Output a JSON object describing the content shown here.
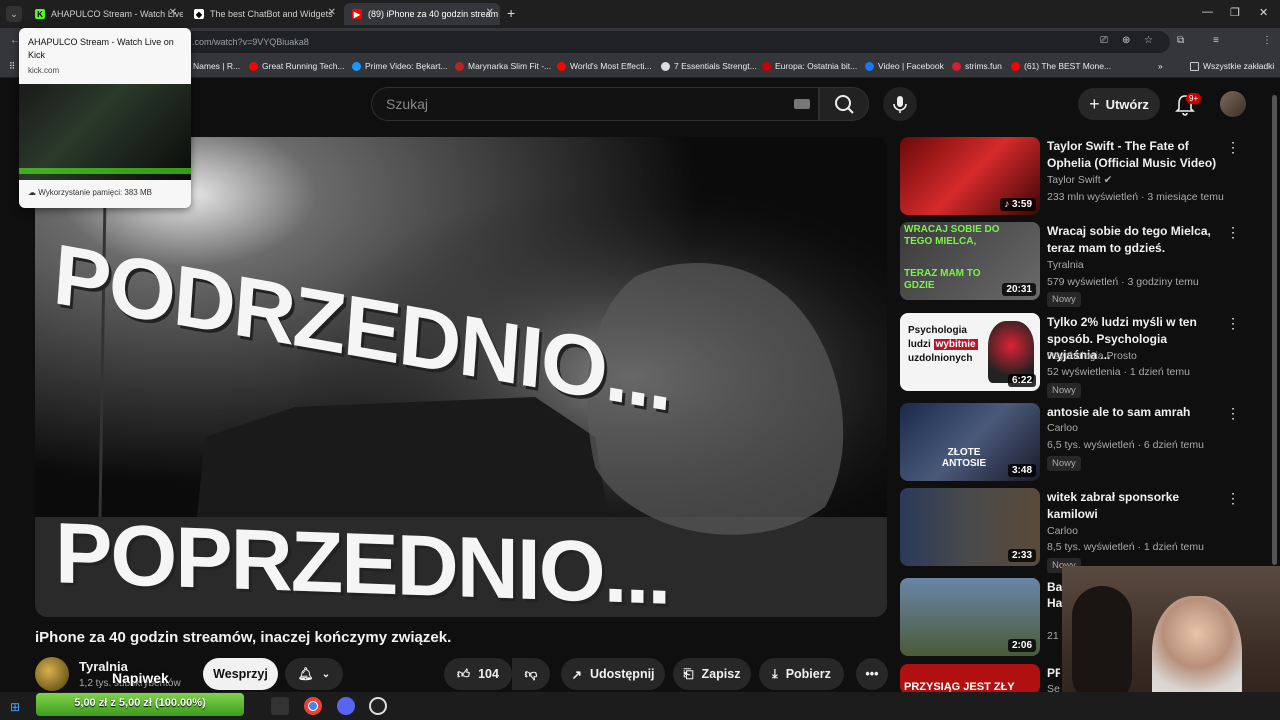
{
  "browser": {
    "tabs": [
      {
        "title": "AHAPULCO Stream - Watch Live",
        "favicon": "kick-icon",
        "color": "#53fc18"
      },
      {
        "title": "The best ChatBot and Widgets",
        "favicon": "streamelements-icon",
        "color": "#ffffff"
      },
      {
        "title": "(89) iPhone za 40 godzin stream",
        "favicon": "youtube-icon",
        "color": "#ff0000"
      }
    ],
    "url": ".com/watch?v=9VYQBiuaka8",
    "bookmarks": [
      "Names | R...",
      "Great Running Tech...",
      "Prime Video: Bękart...",
      "Marynarka Slim Fit -...",
      "World's Most Effecti...",
      "7 Essentials Strengt...",
      "Europa: Ostatnia bit...",
      "Video | Facebook",
      "strims.fun",
      "(61) The BEST Mone..."
    ],
    "bookmarks_all": "Wszystkie zakładki",
    "tab_card": {
      "title": "AHAPULCO Stream - Watch Live on Kick",
      "domain": "kick.com",
      "memory": "Wykorzystanie pamięci: 383 MB"
    }
  },
  "youtube": {
    "search_placeholder": "Szukaj",
    "create_label": "Utwórz",
    "notif_badge": "9+",
    "player_caption_top": "PODRZEDNIO...",
    "player_caption_bottom": "POPRZEDNIO...",
    "video_title": "iPhone za 40 godzin streamów, inaczej kończymy związek.",
    "channel_name": "Tyralnia",
    "channel_subs": "1,2 tys. subskrybentów",
    "overlay_name": "Napiwek",
    "support_label": "Wesprzyj",
    "like_count": "104",
    "share_label": "Udostępnij",
    "save_label": "Zapisz",
    "download_label": "Pobierz",
    "recommendations": [
      {
        "title": "Taylor Swift - The Fate of Ophelia (Official Music Video)",
        "channel": "Taylor Swift",
        "meta": "233 mln wyświetleń · 3 miesiące temu",
        "duration": "3:59",
        "new": ""
      },
      {
        "title": "Wracaj sobie do tego Mielca, teraz mam to gdzieś.",
        "channel": "Tyralnia",
        "meta": "579 wyświetleń · 3 godziny temu",
        "duration": "20:31",
        "new": "Nowy",
        "thumb_text_top": "WRACAJ SOBIE DO TEGO MIELCA,",
        "thumb_text_bottom": "TERAZ MAM TO GDZIE"
      },
      {
        "title": "Tylko 2% ludzi myśli w ten sposób. Psychologia wyjaśnia ...",
        "channel": "Psychologia Prosto",
        "meta": "52 wyświetlenia · 1 dzień temu",
        "duration": "6:22",
        "new": "Nowy",
        "thumb_line1": "Psychologia",
        "thumb_line2a": "ludzi ",
        "thumb_line2b": "wybitnie",
        "thumb_line3": "uzdolnionych"
      },
      {
        "title": "antosie ale to sam amrah",
        "channel": "Carloo",
        "meta": "6,5 tys. wyświetleń · 6 dzień temu",
        "duration": "3:48",
        "new": "Nowy",
        "thumb_text": "ZŁOTE ANTOSIE"
      },
      {
        "title": "witek zabrał sponsorke kamilowi",
        "channel": "Carloo",
        "meta": "8,5 tys. wyświetleń · 1 dzień temu",
        "duration": "2:33",
        "new": "Nowy"
      },
      {
        "title": "Ba",
        "line2": "Ha",
        "meta": "21",
        "duration": "2:06"
      },
      {
        "title": "PR",
        "line2": "Sel",
        "thumb_text": "PRZYSIĄG JEST ZŁY"
      }
    ]
  },
  "taskbar": {
    "progress_text": "5,00 zł z 5,00 zł (100.00%)",
    "progress_percent": 100
  }
}
